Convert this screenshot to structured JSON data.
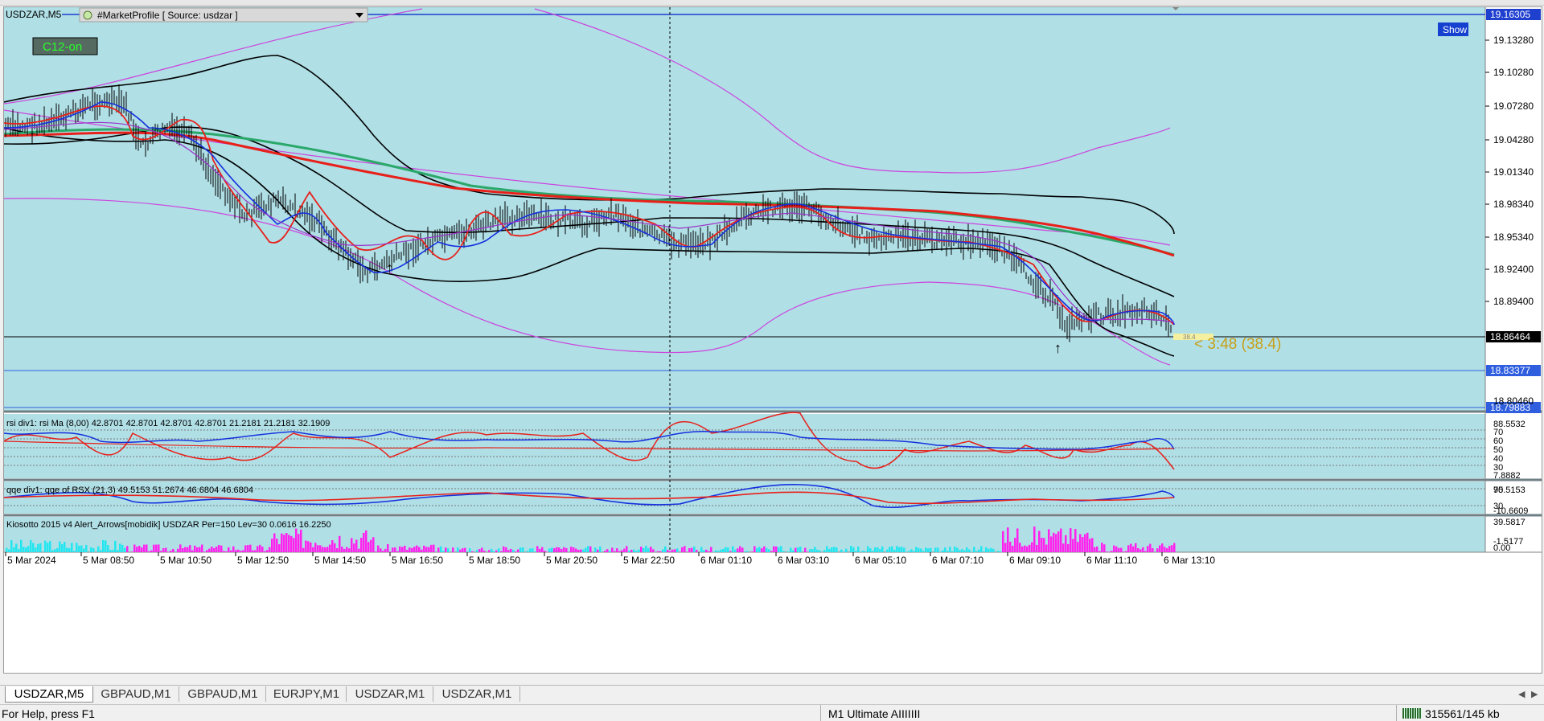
{
  "window": {
    "symbol_title": "USDZAR,M5"
  },
  "indicator_header": {
    "label": "#MarketProfile [ Source: usdzar ]"
  },
  "badges": {
    "c12": "C12-on",
    "show": "Show"
  },
  "price_tag": {
    "label": "< 3:48 (38.4)",
    "small": "38.4"
  },
  "main_price_axis": {
    "levels": [
      "19.13280",
      "19.10280",
      "19.07280",
      "19.04280",
      "19.01340",
      "18.98340",
      "18.95340",
      "18.92400",
      "18.89400",
      "18.86400"
    ],
    "highlighted": [
      {
        "label": "19.16305",
        "color": "#1f3fcf"
      },
      {
        "label": "18.86464",
        "color": "#000000"
      },
      {
        "label": "18.83377",
        "color": "#2f5fdf"
      },
      {
        "label": "18.79883",
        "color": "#2f5fdf"
      }
    ]
  },
  "rsi_panel": {
    "title": "rsi div1: rsi Ma (8,00) 42.8701 42.8701 42.8701 42.8701 21.2181 21.2181 32.1909",
    "axis_top": "88.5532",
    "axis_bottom": "7.8882",
    "levels": [
      "70",
      "60",
      "50",
      "40",
      "30"
    ]
  },
  "qqe_panel": {
    "title": "qqe div1: qqe of RSX (21,3) 49.5153 51.2674 46.6804 46.6804",
    "axis_labels": [
      "95.5153",
      "70",
      "30",
      "-10.6609"
    ]
  },
  "kiosotto_panel": {
    "title": "Kiosotto 2015 v4 Alert_Arrows[mobidik] USDZAR Per=150 Lev=30 0.0616 16.2250",
    "axis_labels": [
      "39.5817",
      "-1.5177",
      "0.00"
    ]
  },
  "time_axis": [
    "5 Mar 2024",
    "5 Mar 08:50",
    "5 Mar 10:50",
    "5 Mar 12:50",
    "5 Mar 14:50",
    "5 Mar 16:50",
    "5 Mar 18:50",
    "5 Mar 20:50",
    "5 Mar 22:50",
    "6 Mar 01:10",
    "6 Mar 03:10",
    "6 Mar 05:10",
    "6 Mar 07:10",
    "6 Mar 09:10",
    "6 Mar 11:10",
    "6 Mar 13:10"
  ],
  "tabs": [
    {
      "label": "USDZAR,M5",
      "active": true
    },
    {
      "label": "GBPAUD,M1",
      "active": false
    },
    {
      "label": "GBPAUD,M1",
      "active": false
    },
    {
      "label": "EURJPY,M1",
      "active": false
    },
    {
      "label": "USDZAR,M1",
      "active": false
    },
    {
      "label": "USDZAR,M1",
      "active": false
    }
  ],
  "status_bar": {
    "help": "For Help, press F1",
    "profile": "M1 Ultimate AIIIIIII",
    "traffic": "315561/145 kb"
  },
  "colors": {
    "chart_bg": "#b0dfe6",
    "ma_red": "#e8201a",
    "ma_green": "#2aa86a",
    "bands": "#000000",
    "envelope": "#cc44dd",
    "blue_line": "#1530dd",
    "hist_magenta": "#ff22ee",
    "hist_cyan": "#22e6f0",
    "tag_gold": "#c8a018"
  }
}
